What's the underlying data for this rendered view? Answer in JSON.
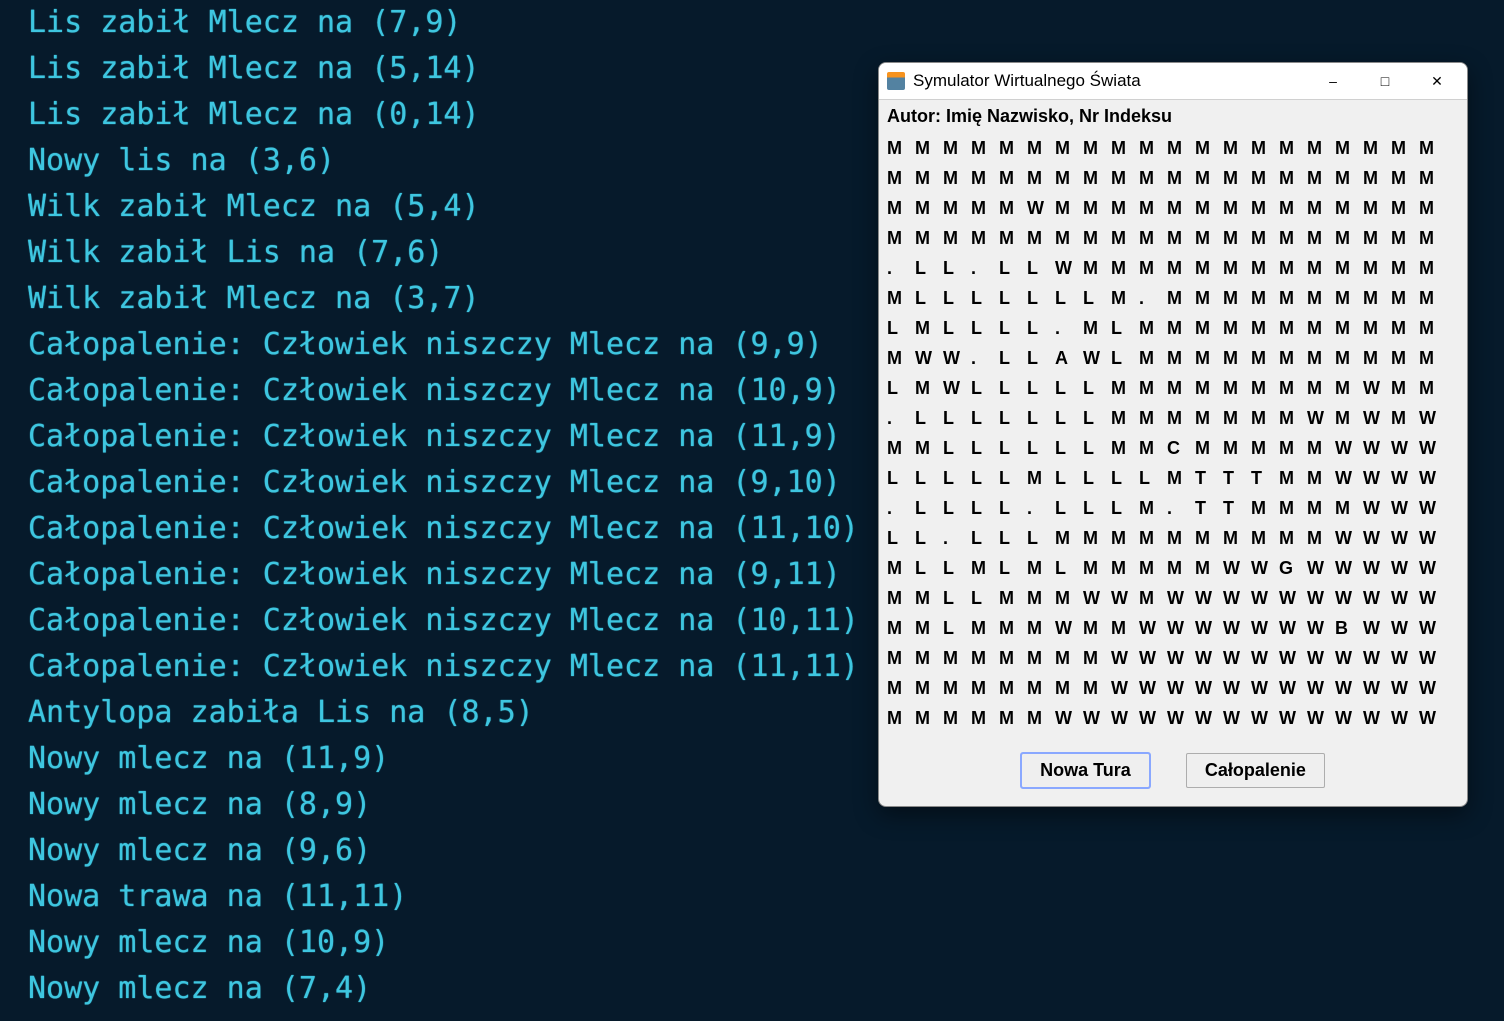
{
  "terminal": {
    "lines": [
      "Lis zabił Mlecz na (7,9)",
      "Lis zabił Mlecz na (5,14)",
      "Lis zabił Mlecz na (0,14)",
      "Nowy lis na (3,6)",
      "Wilk zabił Mlecz na (5,4)",
      "Wilk zabił Lis na (7,6)",
      "Wilk zabił Mlecz na (3,7)",
      "Całopalenie: Człowiek niszczy Mlecz na (9,9)",
      "Całopalenie: Człowiek niszczy Mlecz na (10,9)",
      "Całopalenie: Człowiek niszczy Mlecz na (11,9)",
      "Całopalenie: Człowiek niszczy Mlecz na (9,10)",
      "Całopalenie: Człowiek niszczy Mlecz na (11,10)",
      "Całopalenie: Człowiek niszczy Mlecz na (9,11)",
      "Całopalenie: Człowiek niszczy Mlecz na (10,11)",
      "Całopalenie: Człowiek niszczy Mlecz na (11,11)",
      "Antylopa zabiła Lis na (8,5)",
      "Nowy mlecz na (11,9)",
      "Nowy mlecz na (8,9)",
      "Nowy mlecz na (9,6)",
      "Nowa trawa na (11,11)",
      "Nowy mlecz na (10,9)",
      "Nowy mlecz na (7,4)"
    ]
  },
  "window": {
    "title": "Symulator Wirtualnego Świata",
    "author": "Autor: Imię Nazwisko, Nr Indeksu",
    "buttons": {
      "nowaTura": "Nowa Tura",
      "calopalenie": "Całopalenie"
    },
    "grid": [
      [
        "M",
        "M",
        "M",
        "M",
        "M",
        "M",
        "M",
        "M",
        "M",
        "M",
        "M",
        "M",
        "M",
        "M",
        "M",
        "M",
        "M",
        "M",
        "M",
        "M"
      ],
      [
        "M",
        "M",
        "M",
        "M",
        "M",
        "M",
        "M",
        "M",
        "M",
        "M",
        "M",
        "M",
        "M",
        "M",
        "M",
        "M",
        "M",
        "M",
        "M",
        "M"
      ],
      [
        "M",
        "M",
        "M",
        "M",
        "M",
        "W",
        "M",
        "M",
        "M",
        "M",
        "M",
        "M",
        "M",
        "M",
        "M",
        "M",
        "M",
        "M",
        "M",
        "M"
      ],
      [
        "M",
        "M",
        "M",
        "M",
        "M",
        "M",
        "M",
        "M",
        "M",
        "M",
        "M",
        "M",
        "M",
        "M",
        "M",
        "M",
        "M",
        "M",
        "M",
        "M"
      ],
      [
        ".",
        "L",
        "L",
        ".",
        "L",
        "L",
        "W",
        "M",
        "M",
        "M",
        "M",
        "M",
        "M",
        "M",
        "M",
        "M",
        "M",
        "M",
        "M",
        "M"
      ],
      [
        "M",
        "L",
        "L",
        "L",
        "L",
        "L",
        "L",
        "L",
        "M",
        ".",
        "M",
        "M",
        "M",
        "M",
        "M",
        "M",
        "M",
        "M",
        "M",
        "M"
      ],
      [
        "L",
        "M",
        "L",
        "L",
        "L",
        "L",
        ".",
        "M",
        "L",
        "M",
        "M",
        "M",
        "M",
        "M",
        "M",
        "M",
        "M",
        "M",
        "M",
        "M"
      ],
      [
        "M",
        "W",
        "W",
        ".",
        "L",
        "L",
        "A",
        "W",
        "L",
        "M",
        "M",
        "M",
        "M",
        "M",
        "M",
        "M",
        "M",
        "M",
        "M",
        "M"
      ],
      [
        "L",
        "M",
        "W",
        "L",
        "L",
        "L",
        "L",
        "L",
        "M",
        "M",
        "M",
        "M",
        "M",
        "M",
        "M",
        "M",
        "M",
        "W",
        "M",
        "M"
      ],
      [
        ".",
        "L",
        "L",
        "L",
        "L",
        "L",
        "L",
        "L",
        "M",
        "M",
        "M",
        "M",
        "M",
        "M",
        "M",
        "W",
        "M",
        "W",
        "M",
        "W"
      ],
      [
        "M",
        "M",
        "L",
        "L",
        "L",
        "L",
        "L",
        "L",
        "M",
        "M",
        "C",
        "M",
        "M",
        "M",
        "M",
        "M",
        "W",
        "W",
        "W",
        "W"
      ],
      [
        "L",
        "L",
        "L",
        "L",
        "L",
        "M",
        "L",
        "L",
        "L",
        "L",
        "M",
        "T",
        "T",
        "T",
        "M",
        "M",
        "W",
        "W",
        "W",
        "W"
      ],
      [
        ".",
        "L",
        "L",
        "L",
        "L",
        ".",
        "L",
        "L",
        "L",
        "M",
        ".",
        "T",
        "T",
        "M",
        "M",
        "M",
        "M",
        "W",
        "W",
        "W"
      ],
      [
        "L",
        "L",
        ".",
        "L",
        "L",
        "L",
        "M",
        "M",
        "M",
        "M",
        "M",
        "M",
        "M",
        "M",
        "M",
        "M",
        "W",
        "W",
        "W",
        "W"
      ],
      [
        "M",
        "L",
        "L",
        "M",
        "L",
        "M",
        "L",
        "M",
        "M",
        "M",
        "M",
        "M",
        "W",
        "W",
        "G",
        "W",
        "W",
        "W",
        "W",
        "W"
      ],
      [
        "M",
        "M",
        "L",
        "L",
        "M",
        "M",
        "M",
        "W",
        "W",
        "M",
        "W",
        "W",
        "W",
        "W",
        "W",
        "W",
        "W",
        "W",
        "W",
        "W"
      ],
      [
        "M",
        "M",
        "L",
        "M",
        "M",
        "M",
        "W",
        "M",
        "M",
        "W",
        "W",
        "W",
        "W",
        "W",
        "W",
        "W",
        "B",
        "W",
        "W",
        "W"
      ],
      [
        "M",
        "M",
        "M",
        "M",
        "M",
        "M",
        "M",
        "M",
        "W",
        "W",
        "W",
        "W",
        "W",
        "W",
        "W",
        "W",
        "W",
        "W",
        "W",
        "W"
      ],
      [
        "M",
        "M",
        "M",
        "M",
        "M",
        "M",
        "M",
        "M",
        "W",
        "W",
        "W",
        "W",
        "W",
        "W",
        "W",
        "W",
        "W",
        "W",
        "W",
        "W"
      ],
      [
        "M",
        "M",
        "M",
        "M",
        "M",
        "M",
        "W",
        "W",
        "W",
        "W",
        "W",
        "W",
        "W",
        "W",
        "W",
        "W",
        "W",
        "W",
        "W",
        "W"
      ]
    ]
  },
  "colors": {
    "terminal_bg": "#061a2b",
    "terminal_fg": "#3ec6e0",
    "window_bg": "#f0f0f0"
  }
}
